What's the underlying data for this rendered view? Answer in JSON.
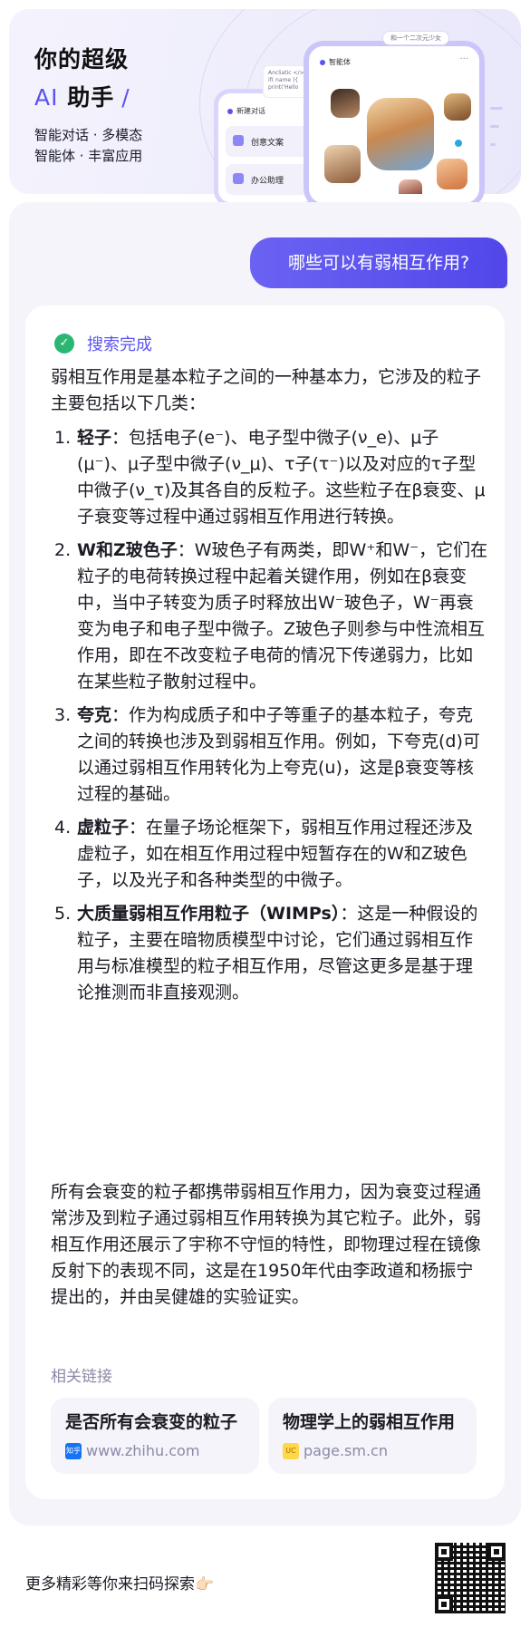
{
  "banner": {
    "title_line1": "你的超级",
    "title_ai": "AI",
    "title_rest": "助手",
    "title_slash": "/",
    "subtitle_line1": "智能对话 · 多模态",
    "subtitle_line2": "智能体 · 丰富应用",
    "mock_back_phone": {
      "header": "新建对话",
      "cards": [
        "创意文案",
        "办公助理"
      ]
    },
    "mock_front_phone": {
      "header": "智能体",
      "tag": "和一个二次元少女"
    },
    "code_snippet": "Ancliatic </>\nif( name ){\nprint('Hello"
  },
  "chat": {
    "user_question": "哪些可以有弱相互作用?",
    "status_text": "搜索完成",
    "intro": "弱相互作用是基本粒子之间的一种基本力，它涉及的粒子主要包括以下几类：",
    "items": [
      {
        "num": "1.",
        "term": "轻子",
        "text": "：包括电子(e⁻)、电子型中微子(ν_e)、μ子(μ⁻)、μ子型中微子(ν_μ)、τ子(τ⁻)以及对应的τ子型中微子(ν_τ)及其各自的反粒子。这些粒子在β衰变、μ子衰变等过程中通过弱相互作用进行转换。"
      },
      {
        "num": "2.",
        "term": "W和Z玻色子",
        "text": "：W玻色子有两类，即W⁺和W⁻，它们在粒子的电荷转换过程中起着关键作用，例如在β衰变中，当中子转变为质子时释放出W⁻玻色子，W⁻再衰变为电子和电子型中微子。Z玻色子则参与中性流相互作用，即在不改变粒子电荷的情况下传递弱力，比如在某些粒子散射过程中。"
      },
      {
        "num": "3.",
        "term": "夸克",
        "text": "：作为构成质子和中子等重子的基本粒子，夸克之间的转换也涉及到弱相互作用。例如，下夸克(d)可以通过弱相互作用转化为上夸克(u)，这是β衰变等核过程的基础。"
      },
      {
        "num": "4.",
        "term": "虚粒子",
        "text": "：在量子场论框架下，弱相互作用过程还涉及虚粒子，如在相互作用过程中短暂存在的W和Z玻色子，以及光子和各种类型的中微子。"
      },
      {
        "num": "5.",
        "term": "大质量弱相互作用粒子（WIMPs）",
        "text": "：这是一种假设的粒子，主要在暗物质模型中讨论，它们通过弱相互作用与标准模型的粒子相互作用，尽管这更多是基于理论推测而非直接观测。"
      }
    ],
    "conclusion": "所有会衰变的粒子都携带弱相互作用力，因为衰变过程通常涉及到粒子通过弱相互作用转换为其它粒子。此外，弱相互作用还展示了宇称不守恒的特性，即物理过程在镜像反射下的表现不同，这是在1950年代由李政道和杨振宁提出的，并由吴健雄的实验证实。",
    "related_label": "相关链接",
    "links": [
      {
        "title": "是否所有会衰变的粒子",
        "icon_text": "知乎",
        "source": "www.zhihu.com"
      },
      {
        "title": "物理学上的弱相互作用",
        "icon_text": "UC",
        "source": "page.sm.cn"
      }
    ]
  },
  "footer": {
    "text": "更多精彩等你来扫码探索👉🏻"
  },
  "colors": {
    "accent": "#5a53f0",
    "bubble": "#5147ea",
    "success": "#2bb673",
    "panel_bg": "#f4f4fa",
    "muted": "#8a8aa8"
  }
}
